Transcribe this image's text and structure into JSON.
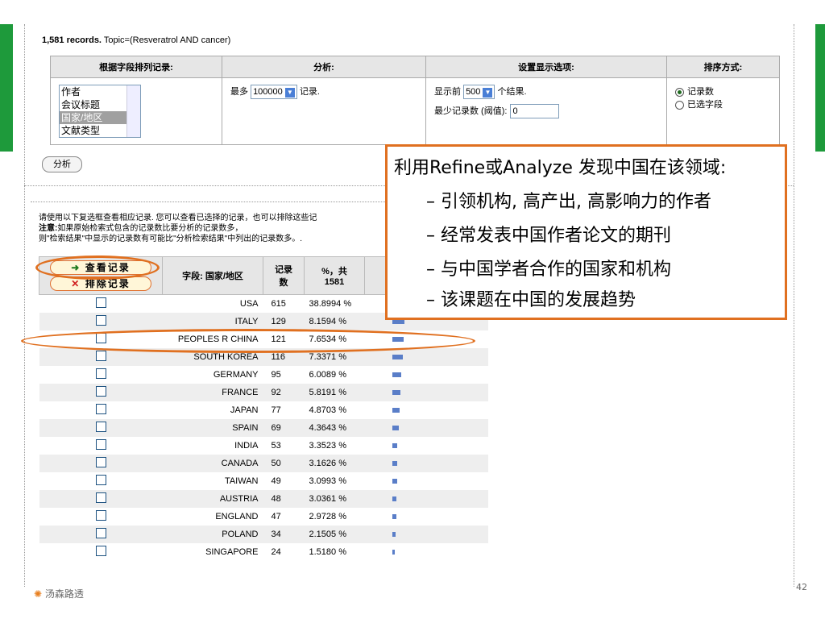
{
  "header": {
    "count": "1,581 records.",
    "topic": "Topic=(Resveratrol AND cancer)"
  },
  "options": {
    "col_titles": [
      "根据字段排列记录:",
      "分析:",
      "设置显示选项:",
      "排序方式:"
    ],
    "fields": [
      "作者",
      "会议标题",
      "国家/地区",
      "文献类型"
    ],
    "analyze_prefix": "最多",
    "analyze_value": "100000",
    "analyze_suffix": "记录.",
    "display_prefix": "显示前",
    "display_value": "500",
    "display_suffix": "个结果.",
    "threshold_label": "最少记录数 (阈值):",
    "threshold_value": "0",
    "sort_options": [
      "记录数",
      "已选字段"
    ],
    "analyze_button": "分析"
  },
  "note": {
    "line1": "请使用以下复选框查看相应记录. 您可以查看已选择的记录，也可以排除这些记",
    "line2_bold": "注意:",
    "line2": "如果原始检索式包含的记录数比要分析的记录数多，",
    "line3": "则\"检索结果\"中显示的记录数有可能比\"分析检索结果\"中列出的记录数多。."
  },
  "results_header": {
    "view_button": "查看记录",
    "exclude_button": "排除记录",
    "field_col": "字段: 国家/地区",
    "count_col_line1": "记录",
    "count_col_line2": "数",
    "pct_col_line1": "%，共",
    "pct_col_line2": "1581"
  },
  "rows": [
    {
      "name": "USA",
      "count": "615",
      "pct": "38.8994 %",
      "fraction": 0.389
    },
    {
      "name": "ITALY",
      "count": "129",
      "pct": "8.1594 %",
      "fraction": 0.0816
    },
    {
      "name": "PEOPLES R CHINA",
      "count": "121",
      "pct": "7.6534 %",
      "fraction": 0.0765
    },
    {
      "name": "SOUTH KOREA",
      "count": "116",
      "pct": "7.3371 %",
      "fraction": 0.0734
    },
    {
      "name": "GERMANY",
      "count": "95",
      "pct": "6.0089 %",
      "fraction": 0.0601
    },
    {
      "name": "FRANCE",
      "count": "92",
      "pct": "5.8191 %",
      "fraction": 0.0582
    },
    {
      "name": "JAPAN",
      "count": "77",
      "pct": "4.8703 %",
      "fraction": 0.0487
    },
    {
      "name": "SPAIN",
      "count": "69",
      "pct": "4.3643 %",
      "fraction": 0.0436
    },
    {
      "name": "INDIA",
      "count": "53",
      "pct": "3.3523 %",
      "fraction": 0.0335
    },
    {
      "name": "CANADA",
      "count": "50",
      "pct": "3.1626 %",
      "fraction": 0.0316
    },
    {
      "name": "TAIWAN",
      "count": "49",
      "pct": "3.0993 %",
      "fraction": 0.031
    },
    {
      "name": "AUSTRIA",
      "count": "48",
      "pct": "3.0361 %",
      "fraction": 0.0304
    },
    {
      "name": "ENGLAND",
      "count": "47",
      "pct": "2.9728 %",
      "fraction": 0.0297
    },
    {
      "name": "POLAND",
      "count": "34",
      "pct": "2.1505 %",
      "fraction": 0.0215
    },
    {
      "name": "SINGAPORE",
      "count": "24",
      "pct": "1.5180 %",
      "fraction": 0.0152
    }
  ],
  "callout": {
    "title": "利用Refine或Analyze 发现中国在该领域:",
    "items": [
      "– 引领机构, 高产出, 高影响力的作者",
      "– 经常发表中国作者论文的期刊",
      "– 与中国学者合作的国家和机构",
      "– 该课题在中国的发展趋势"
    ]
  },
  "footer": {
    "logo_text": "汤森路透",
    "page": "42"
  },
  "colors": {
    "accent": "#e07020",
    "green": "#1e9a3b",
    "bar": "#5a7ec8"
  }
}
